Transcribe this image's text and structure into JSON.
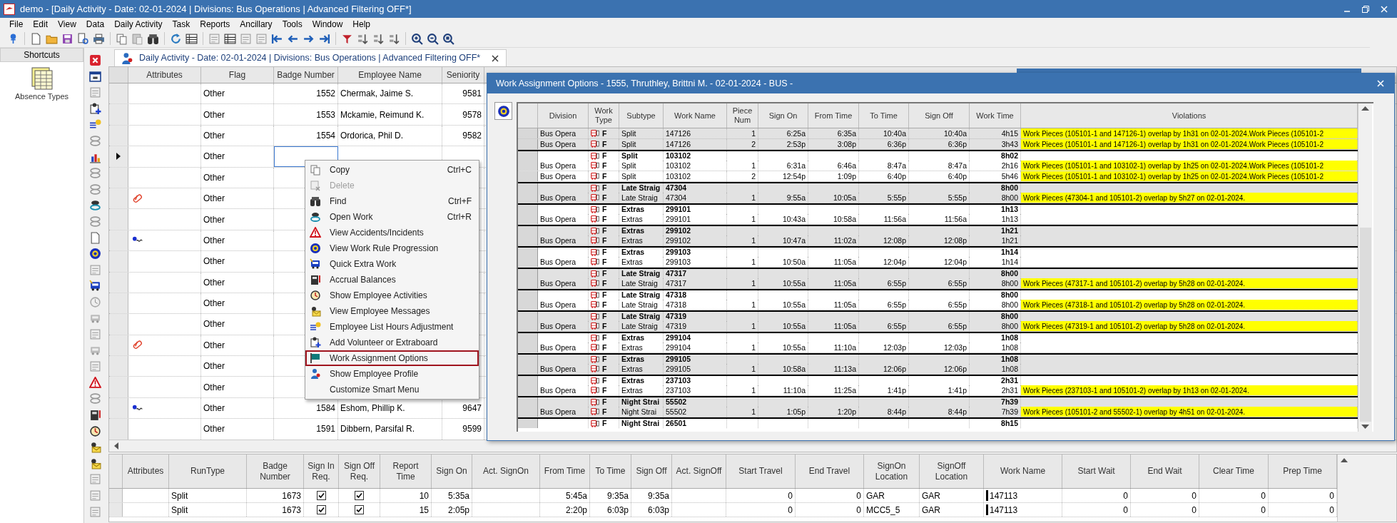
{
  "window": {
    "title": "demo - [Daily Activity - Date: 02-01-2024 | Divisions: Bus Operations | Advanced Filtering OFF*]"
  },
  "menu_bar": [
    "File",
    "Edit",
    "View",
    "Data",
    "Daily Activity",
    "Task",
    "Reports",
    "Ancillary",
    "Tools",
    "Window",
    "Help"
  ],
  "shortcuts": {
    "title": "Shortcuts",
    "items": [
      {
        "label": "Absence Types"
      }
    ]
  },
  "document_tab": {
    "title": "Daily Activity - Date: 02-01-2024 | Divisions: Bus Operations | Advanced Filtering OFF*"
  },
  "employee_grid": {
    "columns": [
      "Attributes",
      "Flag",
      "Badge Number",
      "Employee Name",
      "Seniority"
    ],
    "rows": [
      {
        "kind": "plain",
        "flag": "Other",
        "badge": "1552",
        "name": "Chermak, Jaime S.",
        "seniority": "9581",
        "selected": false
      },
      {
        "kind": "plain",
        "flag": "Other",
        "badge": "1553",
        "name": "Mckamie, Reimund K.",
        "seniority": "9578",
        "selected": false
      },
      {
        "kind": "plain",
        "flag": "Other",
        "badge": "1554",
        "name": "Ordorica, Phil D.",
        "seniority": "9582",
        "selected": false
      },
      {
        "kind": "plain",
        "flag": "Other",
        "selected": true
      },
      {
        "kind": "plain",
        "flag": "Other",
        "selected": false
      },
      {
        "kind": "pill",
        "flag": "Other",
        "selected": false
      },
      {
        "kind": "plain",
        "flag": "Other",
        "selected": false
      },
      {
        "kind": "squiggle",
        "flag": "Other",
        "selected": false
      },
      {
        "kind": "plain",
        "flag": "Other",
        "selected": false
      },
      {
        "kind": "plain",
        "flag": "Other",
        "selected": false
      },
      {
        "kind": "plain",
        "flag": "Other",
        "selected": false
      },
      {
        "kind": "plain",
        "flag": "Other",
        "selected": false
      },
      {
        "kind": "pill",
        "flag": "Other",
        "selected": false
      },
      {
        "kind": "plain",
        "flag": "Other",
        "selected": false
      },
      {
        "kind": "plain",
        "flag": "Other",
        "selected": false
      },
      {
        "kind": "squiggle",
        "flag": "Other",
        "badge": "1584",
        "name": "Eshom, Phillip K.",
        "seniority": "9647",
        "selected": false
      },
      {
        "kind": "plain",
        "flag": "Other",
        "badge": "1591",
        "name": "Dibbern, Parsifal R.",
        "seniority": "9599",
        "selected": false
      }
    ]
  },
  "context_menu": {
    "items": [
      {
        "label": "Copy",
        "shortcut": "Ctrl+C",
        "disabled": false,
        "highlighted": false
      },
      {
        "label": "Delete",
        "disabled": true,
        "highlighted": false
      },
      {
        "label": "Find",
        "shortcut": "Ctrl+F",
        "disabled": false,
        "highlighted": false
      },
      {
        "label": "Open Work",
        "shortcut": "Ctrl+R",
        "disabled": false,
        "highlighted": false
      },
      {
        "label": "View Accidents/Incidents",
        "disabled": false,
        "highlighted": false
      },
      {
        "label": "View Work Rule Progression",
        "disabled": false,
        "highlighted": false
      },
      {
        "label": "Quick Extra Work",
        "disabled": false,
        "highlighted": false
      },
      {
        "label": "Accrual Balances",
        "disabled": false,
        "highlighted": false
      },
      {
        "label": "Show Employee Activities",
        "disabled": false,
        "highlighted": false
      },
      {
        "label": "View Employee Messages",
        "disabled": false,
        "highlighted": false
      },
      {
        "label": "Employee List Hours Adjustment",
        "disabled": false,
        "highlighted": false
      },
      {
        "label": "Add Volunteer or Extraboard",
        "disabled": false,
        "highlighted": false
      },
      {
        "label": "Work Assignment Options",
        "disabled": false,
        "highlighted": true
      },
      {
        "label": "Show Employee Profile",
        "disabled": false,
        "highlighted": false
      },
      {
        "label": "Customize Smart Menu",
        "disabled": false,
        "highlighted": false
      }
    ]
  },
  "dialog": {
    "title": "Work Assignment Options - 1555, Thruthley, Brittni M. - 02-01-2024 - BUS -",
    "columns": [
      "Division",
      "Work Type",
      "Subtype",
      "Work Name",
      "Piece Num",
      "Sign On",
      "From Time",
      "To Time",
      "Sign Off",
      "Work Time",
      "Violations"
    ],
    "rows": [
      {
        "kind": "detail",
        "shaded": true,
        "division": "Bus Opera",
        "work_type": "F",
        "subtype": "Split",
        "work_name": "147126",
        "piece_num": "1",
        "sign_on": "6:25a",
        "from_time": "6:35a",
        "to_time": "10:40a",
        "sign_off": "10:40a",
        "work_time": "4h15",
        "violation": "Work Pieces (105101-1 and 147126-1) overlap by 1h31 on 02-01-2024.Work Pieces (105101-2"
      },
      {
        "kind": "detail",
        "shaded": true,
        "division": "Bus Opera",
        "work_type": "F",
        "subtype": "Split",
        "work_name": "147126",
        "piece_num": "2",
        "sign_on": "2:53p",
        "from_time": "3:08p",
        "to_time": "6:36p",
        "sign_off": "6:36p",
        "work_time": "3h43",
        "violation": "Work Pieces (105101-1 and 147126-1) overlap by 1h31 on 02-01-2024.Work Pieces (105101-2"
      },
      {
        "kind": "summary",
        "shaded": false,
        "work_type": "F",
        "subtype": "Split",
        "work_name": "103102",
        "work_time": "8h02"
      },
      {
        "kind": "detail",
        "shaded": false,
        "division": "Bus Opera",
        "work_type": "F",
        "subtype": "Split",
        "work_name": "103102",
        "piece_num": "1",
        "sign_on": "6:31a",
        "from_time": "6:46a",
        "to_time": "8:47a",
        "sign_off": "8:47a",
        "work_time": "2h16",
        "violation": "Work Pieces (105101-1 and 103102-1) overlap by 1h25 on 02-01-2024.Work Pieces (105101-2"
      },
      {
        "kind": "detail",
        "shaded": false,
        "division": "Bus Opera",
        "work_type": "F",
        "subtype": "Split",
        "work_name": "103102",
        "piece_num": "2",
        "sign_on": "12:54p",
        "from_time": "1:09p",
        "to_time": "6:40p",
        "sign_off": "6:40p",
        "work_time": "5h46",
        "violation": "Work Pieces (105101-1 and 103102-1) overlap by 1h25 on 02-01-2024.Work Pieces (105101-2"
      },
      {
        "kind": "summary",
        "shaded": true,
        "work_type": "F",
        "subtype": "Late Straig",
        "work_name": "47304",
        "work_time": "8h00"
      },
      {
        "kind": "detail",
        "shaded": true,
        "division": "Bus Opera",
        "work_type": "F",
        "subtype": "Late Straig",
        "work_name": "47304",
        "piece_num": "1",
        "sign_on": "9:55a",
        "from_time": "10:05a",
        "to_time": "5:55p",
        "sign_off": "5:55p",
        "work_time": "8h00",
        "violation": "Work Pieces (47304-1 and 105101-2) overlap by 5h27 on 02-01-2024."
      },
      {
        "kind": "summary",
        "shaded": false,
        "work_type": "F",
        "subtype": "Extras",
        "work_name": "299101",
        "work_time": "1h13"
      },
      {
        "kind": "detail",
        "shaded": false,
        "division": "Bus Opera",
        "work_type": "F",
        "subtype": "Extras",
        "work_name": "299101",
        "piece_num": "1",
        "sign_on": "10:43a",
        "from_time": "10:58a",
        "to_time": "11:56a",
        "sign_off": "11:56a",
        "work_time": "1h13"
      },
      {
        "kind": "summary",
        "shaded": true,
        "work_type": "F",
        "subtype": "Extras",
        "work_name": "299102",
        "work_time": "1h21"
      },
      {
        "kind": "detail",
        "shaded": true,
        "division": "Bus Opera",
        "work_type": "F",
        "subtype": "Extras",
        "work_name": "299102",
        "piece_num": "1",
        "sign_on": "10:47a",
        "from_time": "11:02a",
        "to_time": "12:08p",
        "sign_off": "12:08p",
        "work_time": "1h21"
      },
      {
        "kind": "summary",
        "shaded": false,
        "work_type": "F",
        "subtype": "Extras",
        "work_name": "299103",
        "work_time": "1h14"
      },
      {
        "kind": "detail",
        "shaded": false,
        "division": "Bus Opera",
        "work_type": "F",
        "subtype": "Extras",
        "work_name": "299103",
        "piece_num": "1",
        "sign_on": "10:50a",
        "from_time": "11:05a",
        "to_time": "12:04p",
        "sign_off": "12:04p",
        "work_time": "1h14"
      },
      {
        "kind": "summary",
        "shaded": true,
        "work_type": "F",
        "subtype": "Late Straig",
        "work_name": "47317",
        "work_time": "8h00"
      },
      {
        "kind": "detail",
        "shaded": true,
        "division": "Bus Opera",
        "work_type": "F",
        "subtype": "Late Straig",
        "work_name": "47317",
        "piece_num": "1",
        "sign_on": "10:55a",
        "from_time": "11:05a",
        "to_time": "6:55p",
        "sign_off": "6:55p",
        "work_time": "8h00",
        "violation": "Work Pieces (47317-1 and 105101-2) overlap by 5h28 on 02-01-2024."
      },
      {
        "kind": "summary",
        "shaded": false,
        "work_type": "F",
        "subtype": "Late Straig",
        "work_name": "47318",
        "work_time": "8h00"
      },
      {
        "kind": "detail",
        "shaded": false,
        "division": "Bus Opera",
        "work_type": "F",
        "subtype": "Late Straig",
        "work_name": "47318",
        "piece_num": "1",
        "sign_on": "10:55a",
        "from_time": "11:05a",
        "to_time": "6:55p",
        "sign_off": "6:55p",
        "work_time": "8h00",
        "violation": "Work Pieces (47318-1 and 105101-2) overlap by 5h28 on 02-01-2024."
      },
      {
        "kind": "summary",
        "shaded": true,
        "work_type": "F",
        "subtype": "Late Straig",
        "work_name": "47319",
        "work_time": "8h00"
      },
      {
        "kind": "detail",
        "shaded": true,
        "division": "Bus Opera",
        "work_type": "F",
        "subtype": "Late Straig",
        "work_name": "47319",
        "piece_num": "1",
        "sign_on": "10:55a",
        "from_time": "11:05a",
        "to_time": "6:55p",
        "sign_off": "6:55p",
        "work_time": "8h00",
        "violation": "Work Pieces (47319-1 and 105101-2) overlap by 5h28 on 02-01-2024."
      },
      {
        "kind": "summary",
        "shaded": false,
        "work_type": "F",
        "subtype": "Extras",
        "work_name": "299104",
        "work_time": "1h08"
      },
      {
        "kind": "detail",
        "shaded": false,
        "division": "Bus Opera",
        "work_type": "F",
        "subtype": "Extras",
        "work_name": "299104",
        "piece_num": "1",
        "sign_on": "10:55a",
        "from_time": "11:10a",
        "to_time": "12:03p",
        "sign_off": "12:03p",
        "work_time": "1h08"
      },
      {
        "kind": "summary",
        "shaded": true,
        "work_type": "F",
        "subtype": "Extras",
        "work_name": "299105",
        "work_time": "1h08"
      },
      {
        "kind": "detail",
        "shaded": true,
        "division": "Bus Opera",
        "work_type": "F",
        "subtype": "Extras",
        "work_name": "299105",
        "piece_num": "1",
        "sign_on": "10:58a",
        "from_time": "11:13a",
        "to_time": "12:06p",
        "sign_off": "12:06p",
        "work_time": "1h08"
      },
      {
        "kind": "summary",
        "shaded": false,
        "work_type": "F",
        "subtype": "Extras",
        "work_name": "237103",
        "work_time": "2h31"
      },
      {
        "kind": "detail",
        "shaded": false,
        "division": "Bus Opera",
        "work_type": "F",
        "subtype": "Extras",
        "work_name": "237103",
        "piece_num": "1",
        "sign_on": "11:10a",
        "from_time": "11:25a",
        "to_time": "1:41p",
        "sign_off": "1:41p",
        "work_time": "2h31",
        "violation": "Work Pieces (237103-1 and 105101-2) overlap by 1h13 on 02-01-2024."
      },
      {
        "kind": "summary",
        "shaded": true,
        "work_type": "F",
        "subtype": "Night Strai",
        "work_name": "55502",
        "work_time": "7h39"
      },
      {
        "kind": "detail",
        "shaded": true,
        "division": "Bus Opera",
        "work_type": "F",
        "subtype": "Night Strai",
        "work_name": "55502",
        "piece_num": "1",
        "sign_on": "1:05p",
        "from_time": "1:20p",
        "to_time": "8:44p",
        "sign_off": "8:44p",
        "work_time": "7h39",
        "violation": "Work Pieces (105101-2 and 55502-1) overlap by 4h51 on 02-01-2024."
      },
      {
        "kind": "summary",
        "shaded": false,
        "work_type": "F",
        "subtype": "Night Strai",
        "work_name": "26501",
        "work_time": "8h15"
      }
    ]
  },
  "assignment_grid": {
    "columns": [
      "Attributes",
      "RunType",
      "Badge Number",
      "Sign In Req.",
      "Sign Off Req.",
      "Report Time",
      "Sign On",
      "Act. SignOn",
      "From Time",
      "To Time",
      "Sign Off",
      "Act. SignOff",
      "Start Travel",
      "End Travel",
      "SignOn Location",
      "SignOff Location",
      "Work Name",
      "Start Wait",
      "End Wait",
      "Clear Time",
      "Prep Time"
    ],
    "rows": [
      {
        "run_type": "Split",
        "badge": "1673",
        "sign_in_req": true,
        "sign_off_req": true,
        "report_time": "10",
        "sign_on": "5:35a",
        "from_time": "5:45a",
        "to_time": "9:35a",
        "sign_off": "9:35a",
        "start_travel": "0",
        "end_travel": "0",
        "sign_on_location": "GAR",
        "sign_off_location": "GAR",
        "work_name": "147113",
        "start_wait": "0",
        "end_wait": "0",
        "clear_time": "0",
        "prep_time": "0"
      },
      {
        "run_type": "Split",
        "badge": "1673",
        "sign_in_req": true,
        "sign_off_req": true,
        "report_time": "15",
        "sign_on": "2:05p",
        "from_time": "2:20p",
        "to_time": "6:03p",
        "sign_off": "6:03p",
        "start_travel": "0",
        "end_travel": "0",
        "sign_on_location": "MCC5_5",
        "sign_off_location": "GAR",
        "work_name": "147113",
        "start_wait": "0",
        "end_wait": "0",
        "clear_time": "0",
        "prep_time": "0"
      }
    ]
  }
}
